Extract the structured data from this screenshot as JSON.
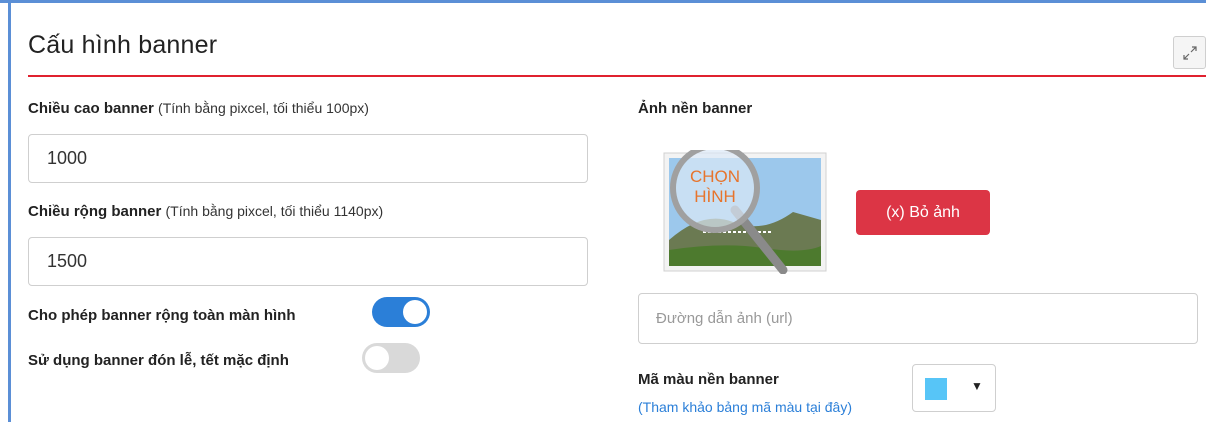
{
  "panel": {
    "title": "Cấu hình banner",
    "expand_icon": "expand-arrows-icon"
  },
  "height_field": {
    "label": "Chiều cao banner",
    "hint": "(Tính bằng pixcel, tối thiểu 100px)",
    "value": "1000"
  },
  "width_field": {
    "label": "Chiều rộng banner",
    "hint": "(Tính bằng pixcel, tối thiểu 1140px)",
    "value": "1500"
  },
  "toggles": {
    "fullwidth": {
      "label": "Cho phép banner rộng toàn màn hình",
      "on": true
    },
    "holiday": {
      "label": "Sử dụng banner đón lễ, tết mặc định",
      "on": false
    }
  },
  "background_image": {
    "label": "Ảnh nền banner",
    "picker_text_line1": "CHỌN",
    "picker_text_line2": "HÌNH",
    "remove_label": "(x) Bỏ ảnh",
    "url_placeholder": "Đường dẫn ảnh (url)"
  },
  "background_color": {
    "label": "Mã màu nền banner",
    "link": "(Tham khảo bảng mã màu tại đây)",
    "value": "#57c5f7"
  },
  "colors": {
    "accent": "#2b7fd8",
    "danger": "#dc3545",
    "rule": "#e0212f",
    "frame": "#5b8fd6"
  }
}
